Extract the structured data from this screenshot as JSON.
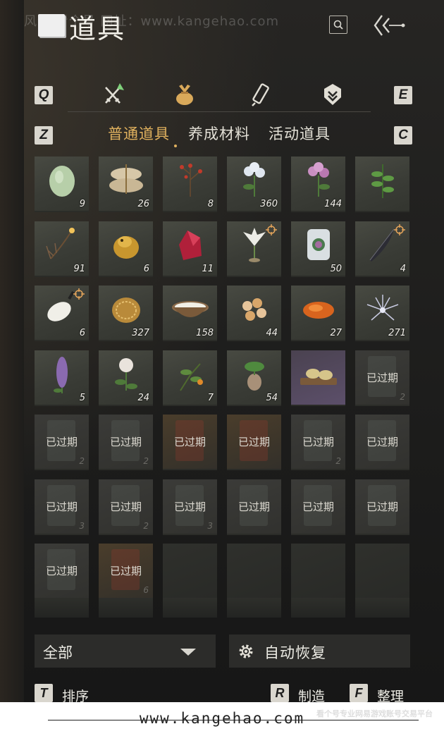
{
  "header": {
    "title": "道具",
    "watermark": "风气 看个号 网址：www.kangehao.com"
  },
  "top_tabs": {
    "left_key": "Q",
    "right_key": "E",
    "icons": [
      "crossed-swords-icon",
      "item-bundle-icon",
      "scroll-icon",
      "badge-icon"
    ],
    "active_index": 1
  },
  "sub_tabs": {
    "left_key": "Z",
    "right_key": "C",
    "items": [
      "普通道具",
      "养成材料",
      "活动道具"
    ],
    "active_index": 0
  },
  "colors": {
    "accent": "#e0b15e",
    "cell_bg": "#3c3e37",
    "panel_bg": "#2c2c2a"
  },
  "grid": {
    "items": [
      {
        "name": "melon-item",
        "count": "9"
      },
      {
        "name": "sacks-item",
        "count": "26"
      },
      {
        "name": "red-berry-branch-item",
        "count": "8"
      },
      {
        "name": "white-flower-item",
        "count": "360"
      },
      {
        "name": "purple-flower-item",
        "count": "144"
      },
      {
        "name": "green-herb-item",
        "count": ""
      },
      {
        "name": "feather-torch-item",
        "count": "91"
      },
      {
        "name": "golden-toad-item",
        "count": "6"
      },
      {
        "name": "red-crystal-item",
        "count": "11"
      },
      {
        "name": "white-lily-item",
        "count": "",
        "tracked": true
      },
      {
        "name": "ice-flower-item",
        "count": "50"
      },
      {
        "name": "dark-feather-item",
        "count": "4",
        "tracked": true
      },
      {
        "name": "white-fur-item",
        "count": "6",
        "tracked": true
      },
      {
        "name": "golden-scale-item",
        "count": "327"
      },
      {
        "name": "milk-bowl-item",
        "count": "158"
      },
      {
        "name": "amber-pieces-item",
        "count": "44"
      },
      {
        "name": "orange-stone-item",
        "count": "27"
      },
      {
        "name": "silver-flower-item",
        "count": "271"
      },
      {
        "name": "purple-spike-flower-item",
        "count": "5"
      },
      {
        "name": "white-rose-item",
        "count": "24"
      },
      {
        "name": "orange-fruit-branch-item",
        "count": "7"
      },
      {
        "name": "root-herb-item",
        "count": "54"
      },
      {
        "name": "pastry-tray-item",
        "count": ""
      }
    ],
    "expired": [
      {
        "label": "已过期",
        "count": "2",
        "tone": "gray"
      },
      {
        "label": "已过期",
        "count": "2",
        "tone": "gray"
      },
      {
        "label": "已过期",
        "count": "2",
        "tone": "gray"
      },
      {
        "label": "已过期",
        "count": "",
        "tone": "warm"
      },
      {
        "label": "已过期",
        "count": "",
        "tone": "warm"
      },
      {
        "label": "已过期",
        "count": "2",
        "tone": "gray"
      },
      {
        "label": "已过期",
        "count": "",
        "tone": "gray"
      },
      {
        "label": "已过期",
        "count": "3",
        "tone": "gray"
      },
      {
        "label": "已过期",
        "count": "2",
        "tone": "gray"
      },
      {
        "label": "已过期",
        "count": "3",
        "tone": "gray"
      },
      {
        "label": "已过期",
        "count": "",
        "tone": "gray"
      },
      {
        "label": "已过期",
        "count": "",
        "tone": "gray"
      },
      {
        "label": "已过期",
        "count": "",
        "tone": "gray"
      },
      {
        "label": "已过期",
        "count": "",
        "tone": "gray"
      },
      {
        "label": "已过期",
        "count": "6",
        "tone": "warm"
      }
    ]
  },
  "bottom": {
    "filter_value": "全部",
    "auto_restore": "自动恢复",
    "sort_key": "T",
    "sort_label": "排序",
    "craft_key": "R",
    "craft_label": "制造",
    "organize_key": "F",
    "organize_label": "整理"
  },
  "footer": {
    "url": "www.kangehao.com",
    "watermark_text": "看个号专业网易游戏账号交易平台"
  }
}
